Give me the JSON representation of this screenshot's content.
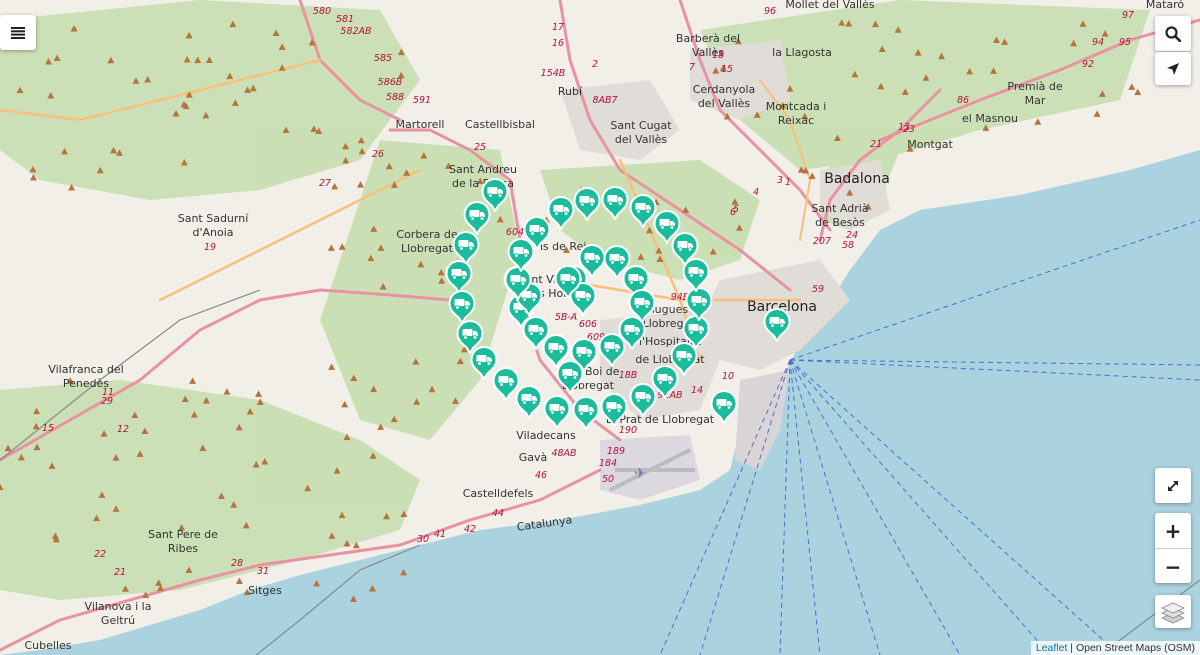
{
  "map": {
    "labels": {
      "cities": [
        "Barcelona",
        "Badalona"
      ],
      "towns": [
        "Mataró",
        "Mollet del Vallès",
        "Barberà del",
        "Vallès",
        "la Llagosta",
        "Cerdanyola",
        "del Vallès",
        "Montcada i",
        "Reixac",
        "Premià de",
        "Mar",
        "el Masnou",
        "Montgat",
        "Sant Adrià",
        "de Besòs",
        "Rubí",
        "Sant Cugat",
        "del Vallès",
        "Martorell",
        "Castellbisbal",
        "Sant Andreu",
        "de la Barca",
        "Sant Sadurní",
        "d'Anoia",
        "Corbera de",
        "Llobregat",
        "Vilafranca del",
        "Penedès",
        "Sant Pere de",
        "Ribes",
        "Vilanova i la",
        "Geltrú",
        "Sitges",
        "Cubelles",
        "Castelldefels",
        "Gavà",
        "Viladecans",
        "Sant Boi de",
        "Llobregat",
        "l'Hospitalet",
        "de Llobregat",
        "El Prat de Llobregat",
        "Esplugues",
        "de Llobregat",
        "Sant Vicenç",
        "dels Horts",
        "Molins de Rei",
        "Catalunya"
      ],
      "roads": [
        "580",
        "581",
        "582AB",
        "585",
        "586B",
        "588",
        "591",
        "25",
        "26",
        "27",
        "19",
        "17",
        "16",
        "2",
        "154B",
        "8AB7",
        "7",
        "15",
        "18",
        "96",
        "97",
        "95",
        "94",
        "92",
        "86",
        "6",
        "5",
        "4",
        "1",
        "3",
        "23",
        "21",
        "13",
        "207",
        "24",
        "58",
        "59",
        "604",
        "5B-A",
        "606",
        "609",
        "18B",
        "14",
        "10",
        "94B",
        "192AB",
        "190",
        "189",
        "184",
        "50",
        "48AB",
        "46",
        "44",
        "42",
        "41",
        "30",
        "31",
        "28",
        "29",
        "11",
        "12",
        "15",
        "22",
        "21"
      ]
    },
    "marker_icon": "truck-icon",
    "marker_count": 52,
    "colors": {
      "marker": "#1abc9c",
      "sea": "#aad3df",
      "land": "#f2efe9",
      "forest": "#c8dfb4"
    }
  },
  "controls": {
    "menu_icon": "menu-icon",
    "search_icon": "search-icon",
    "locate_icon": "locate-arrow-icon",
    "fullscreen_icon": "fullscreen-icon",
    "zoom_in_label": "+",
    "zoom_out_label": "−",
    "layers_icon": "layers-icon"
  },
  "attribution": {
    "leaflet": "Leaflet",
    "separator": " | ",
    "osm": "Open Street Maps (OSM)"
  }
}
